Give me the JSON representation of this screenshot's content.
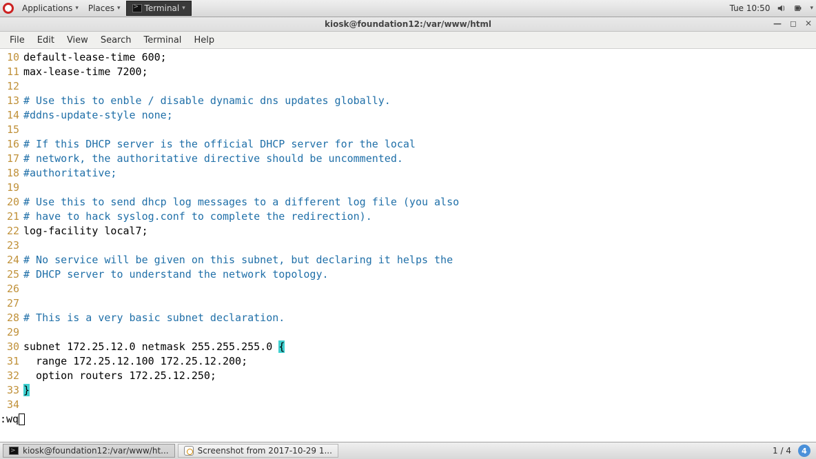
{
  "top_panel": {
    "applications": "Applications",
    "places": "Places",
    "terminal": "Terminal",
    "clock": "Tue 10:50"
  },
  "window": {
    "title": "kiosk@foundation12:/var/www/html"
  },
  "menubar": {
    "file": "File",
    "edit": "Edit",
    "view": "View",
    "search": "Search",
    "terminal": "Terminal",
    "help": "Help"
  },
  "editor": {
    "lines": [
      {
        "n": "10",
        "segs": [
          [
            "black",
            "default-lease-time 600;"
          ]
        ]
      },
      {
        "n": "11",
        "segs": [
          [
            "black",
            "max-lease-time 7200;"
          ]
        ]
      },
      {
        "n": "12",
        "segs": []
      },
      {
        "n": "13",
        "segs": [
          [
            "blue",
            "# Use this to enble / disable dynamic dns updates globally."
          ]
        ]
      },
      {
        "n": "14",
        "segs": [
          [
            "blue",
            "#ddns-update-style none;"
          ]
        ]
      },
      {
        "n": "15",
        "segs": []
      },
      {
        "n": "16",
        "segs": [
          [
            "blue",
            "# If this DHCP server is the official DHCP server for the local"
          ]
        ]
      },
      {
        "n": "17",
        "segs": [
          [
            "blue",
            "# network, the authoritative directive should be uncommented."
          ]
        ]
      },
      {
        "n": "18",
        "segs": [
          [
            "blue",
            "#authoritative;"
          ]
        ]
      },
      {
        "n": "19",
        "segs": []
      },
      {
        "n": "20",
        "segs": [
          [
            "blue",
            "# Use this to send dhcp log messages to a different log file (you also"
          ]
        ]
      },
      {
        "n": "21",
        "segs": [
          [
            "blue",
            "# have to hack syslog.conf to complete the redirection)."
          ]
        ]
      },
      {
        "n": "22",
        "segs": [
          [
            "black",
            "log-facility local7;"
          ]
        ]
      },
      {
        "n": "23",
        "segs": []
      },
      {
        "n": "24",
        "segs": [
          [
            "blue",
            "# No service will be given on this subnet, but declaring it helps the"
          ]
        ]
      },
      {
        "n": "25",
        "segs": [
          [
            "blue",
            "# DHCP server to understand the network topology."
          ]
        ]
      },
      {
        "n": "26",
        "segs": []
      },
      {
        "n": "27",
        "segs": []
      },
      {
        "n": "28",
        "segs": [
          [
            "blue",
            "# This is a very basic subnet declaration."
          ]
        ]
      },
      {
        "n": "29",
        "segs": []
      },
      {
        "n": "30",
        "segs": [
          [
            "black",
            "subnet 172.25.12.0 netmask 255.255.255.0 "
          ],
          [
            "brace-hl",
            "{"
          ]
        ]
      },
      {
        "n": "31",
        "segs": [
          [
            "black",
            "  range 172.25.12.100 172.25.12.200;"
          ]
        ]
      },
      {
        "n": "32",
        "segs": [
          [
            "black",
            "  option routers 172.25.12.250;"
          ]
        ]
      },
      {
        "n": "33",
        "segs": [
          [
            "brace-hl",
            "}"
          ]
        ]
      },
      {
        "n": "34",
        "segs": []
      }
    ],
    "cmd": ":wq"
  },
  "bottom_panel": {
    "task1": "kiosk@foundation12:/var/www/ht...",
    "task2": "Screenshot from 2017-10-29 1...",
    "pager": "1 / 4",
    "ws": "4"
  }
}
